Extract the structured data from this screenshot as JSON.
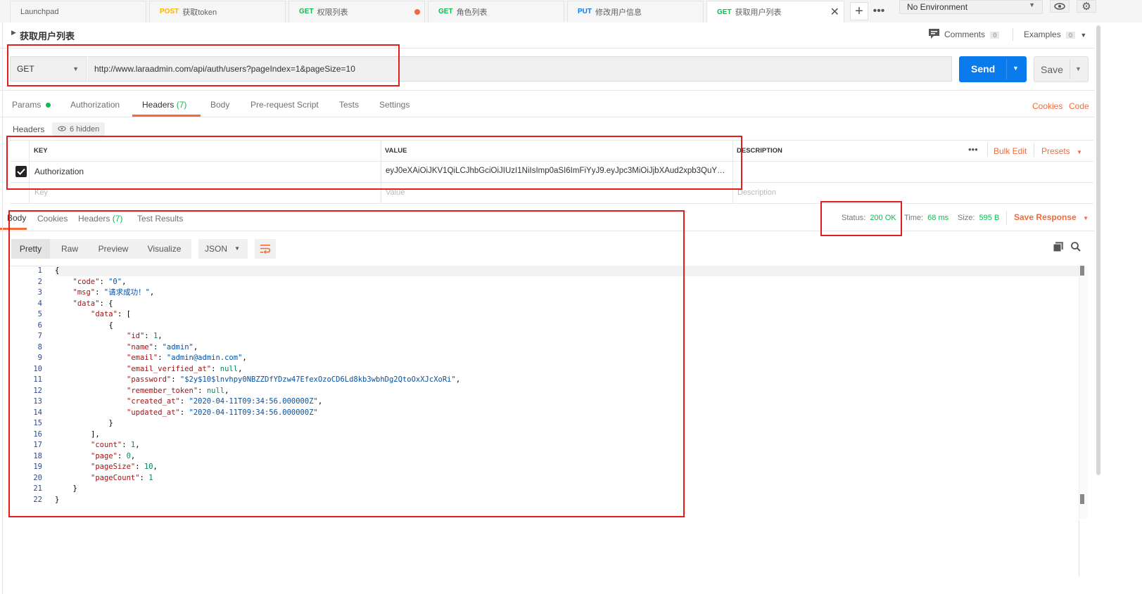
{
  "tabs": [
    {
      "method": "",
      "label": "Launchpad"
    },
    {
      "method": "POST",
      "label": "获取token"
    },
    {
      "method": "GET",
      "label": "权限列表"
    },
    {
      "method": "GET",
      "label": "角色列表"
    },
    {
      "method": "PUT",
      "label": "修改用户信息"
    },
    {
      "method": "GET",
      "label": "获取用户列表"
    }
  ],
  "environment": "No Environment",
  "request": {
    "name": "获取用户列表",
    "comments_label": "Comments",
    "comments_count": "0",
    "examples_label": "Examples",
    "examples_count": "0",
    "method": "GET",
    "url": "http://www.laraadmin.com/api/auth/users?pageIndex=1&pageSize=10",
    "send": "Send",
    "save": "Save"
  },
  "req_tabs": [
    "Params",
    "Authorization",
    "Headers",
    "(7)",
    "Body",
    "Pre-request Script",
    "Tests",
    "Settings"
  ],
  "req_links": [
    "Cookies",
    "Code"
  ],
  "headers_section": {
    "title": "Headers",
    "hidden": "6 hidden",
    "col_key": "KEY",
    "col_value": "VALUE",
    "col_desc": "DESCRIPTION",
    "bulk_edit": "Bulk Edit",
    "presets": "Presets",
    "row_key": "Authorization",
    "row_value": "eyJ0eXAiOiJKV1QiLCJhbGciOiJIUzI1NiIsImp0aSI6ImFiYyJ9.eyJpc3MiOiJjbXAud2xpb3QuY29t...",
    "ph_key": "Key",
    "ph_value": "Value",
    "ph_desc": "Description"
  },
  "response": {
    "tabs": [
      "Body",
      "Cookies",
      "Headers",
      "(7)",
      "Test Results"
    ],
    "status_label": "Status:",
    "status_value": "200 OK",
    "time_label": "Time:",
    "time_value": "68 ms",
    "size_label": "Size:",
    "size_value": "595 B",
    "save_response": "Save Response",
    "views": [
      "Pretty",
      "Raw",
      "Preview",
      "Visualize"
    ],
    "format": "JSON"
  },
  "body_lines": [
    [
      [
        "pun",
        "{"
      ]
    ],
    [
      [
        "key",
        "\"code\""
      ],
      [
        "pun",
        ": "
      ],
      [
        "str",
        "\"0\""
      ],
      [
        "pun",
        ","
      ]
    ],
    [
      [
        "key",
        "\"msg\""
      ],
      [
        "pun",
        ": "
      ],
      [
        "str",
        "\"请求成功！\""
      ],
      [
        "pun",
        ","
      ]
    ],
    [
      [
        "key",
        "\"data\""
      ],
      [
        "pun",
        ": {"
      ]
    ],
    [
      [
        "key",
        "\"data\""
      ],
      [
        "pun",
        ": ["
      ]
    ],
    [
      [
        "pun",
        "{"
      ]
    ],
    [
      [
        "key",
        "\"id\""
      ],
      [
        "pun",
        ": "
      ],
      [
        "num",
        "1"
      ],
      [
        "pun",
        ","
      ]
    ],
    [
      [
        "key",
        "\"name\""
      ],
      [
        "pun",
        ": "
      ],
      [
        "str",
        "\"admin\""
      ],
      [
        "pun",
        ","
      ]
    ],
    [
      [
        "key",
        "\"email\""
      ],
      [
        "pun",
        ": "
      ],
      [
        "str",
        "\"admin@admin.com\""
      ],
      [
        "pun",
        ","
      ]
    ],
    [
      [
        "key",
        "\"email_verified_at\""
      ],
      [
        "pun",
        ": "
      ],
      [
        "num",
        "null"
      ],
      [
        "pun",
        ","
      ]
    ],
    [
      [
        "key",
        "\"password\""
      ],
      [
        "pun",
        ": "
      ],
      [
        "str",
        "\"$2y$10$lnvhpy0NBZZDfYDzw47EfexOzoCD6Ld8kb3wbhDg2QtoOxXJcXoRi\""
      ],
      [
        "pun",
        ","
      ]
    ],
    [
      [
        "key",
        "\"remember_token\""
      ],
      [
        "pun",
        ": "
      ],
      [
        "num",
        "null"
      ],
      [
        "pun",
        ","
      ]
    ],
    [
      [
        "key",
        "\"created_at\""
      ],
      [
        "pun",
        ": "
      ],
      [
        "str",
        "\"2020-04-11T09:34:56.000000Z\""
      ],
      [
        "pun",
        ","
      ]
    ],
    [
      [
        "key",
        "\"updated_at\""
      ],
      [
        "pun",
        ": "
      ],
      [
        "str",
        "\"2020-04-11T09:34:56.000000Z\""
      ]
    ],
    [
      [
        "pun",
        "}"
      ]
    ],
    [
      [
        "pun",
        "],"
      ]
    ],
    [
      [
        "key",
        "\"count\""
      ],
      [
        "pun",
        ": "
      ],
      [
        "num",
        "1"
      ],
      [
        "pun",
        ","
      ]
    ],
    [
      [
        "key",
        "\"page\""
      ],
      [
        "pun",
        ": "
      ],
      [
        "num",
        "0"
      ],
      [
        "pun",
        ","
      ]
    ],
    [
      [
        "key",
        "\"pageSize\""
      ],
      [
        "pun",
        ": "
      ],
      [
        "num",
        "10"
      ],
      [
        "pun",
        ","
      ]
    ],
    [
      [
        "key",
        "\"pageCount\""
      ],
      [
        "pun",
        ": "
      ],
      [
        "num",
        "1"
      ]
    ],
    [
      [
        "pun",
        "}"
      ]
    ],
    [
      [
        "pun",
        "}"
      ]
    ]
  ],
  "body_indent": [
    0,
    1,
    1,
    1,
    2,
    3,
    4,
    4,
    4,
    4,
    4,
    4,
    4,
    4,
    3,
    2,
    2,
    2,
    2,
    2,
    1,
    0
  ]
}
